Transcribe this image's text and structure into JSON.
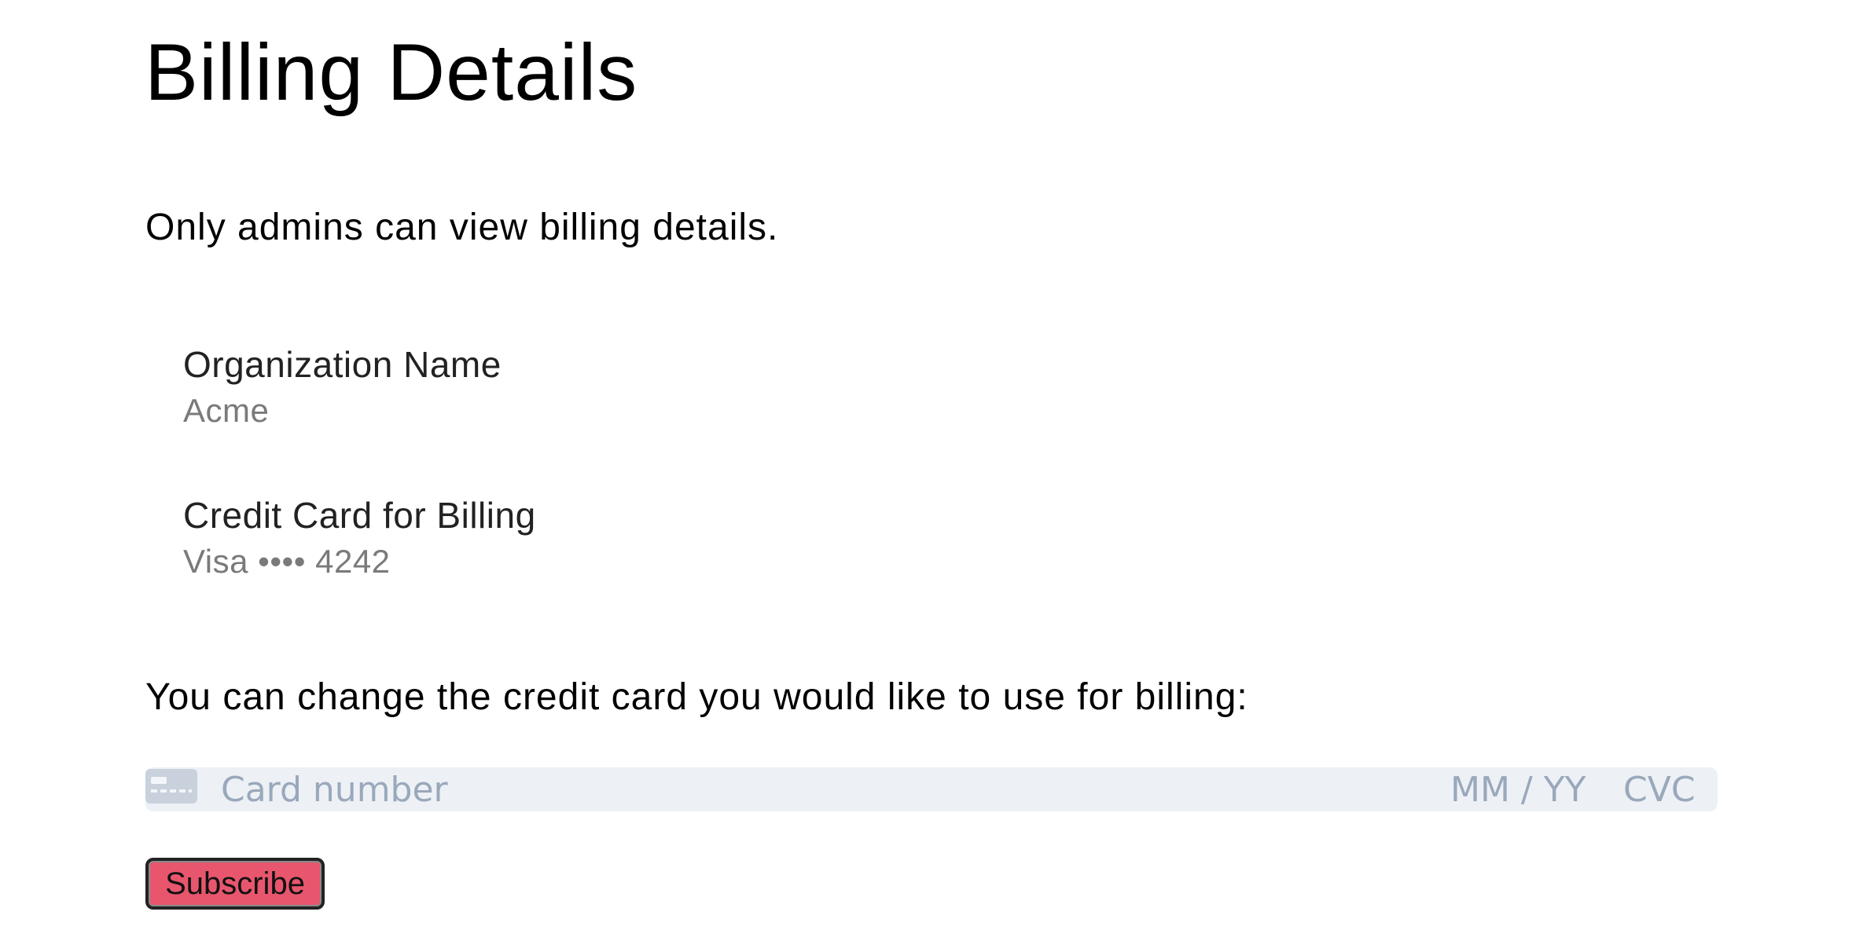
{
  "page": {
    "title": "Billing Details",
    "admin_note": "Only admins can view billing details."
  },
  "details": [
    {
      "label": "Organization Name",
      "value": "Acme"
    },
    {
      "label": "Credit Card for Billing",
      "value": "Visa •••• 4242"
    }
  ],
  "change_card": {
    "note": "You can change the credit card you would like to use for billing:",
    "card_icon": "credit-card-icon",
    "card_number_placeholder": "Card number",
    "expiry_placeholder": "MM / YY",
    "cvc_placeholder": "CVC",
    "field_background": "#edf1f6",
    "placeholder_color": "#9aa8bb"
  },
  "subscribe": {
    "label": "Subscribe",
    "color": "#e8566d"
  }
}
